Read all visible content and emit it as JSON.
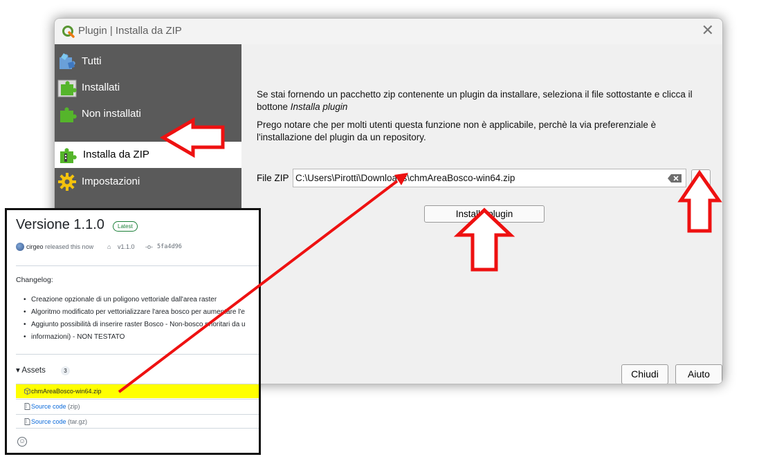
{
  "dialog": {
    "title": "Plugin | Installa da ZIP",
    "close_glyph": "✕"
  },
  "sidebar": {
    "items": [
      {
        "label": "Tutti",
        "icon": "puzzle-multi-icon"
      },
      {
        "label": "Installati",
        "icon": "puzzle-installed-icon"
      },
      {
        "label": "Non installati",
        "icon": "puzzle-icon"
      },
      {
        "label": "Installa da ZIP",
        "icon": "puzzle-zip-icon",
        "active": true
      },
      {
        "label": "Impostazioni",
        "icon": "gear-icon"
      }
    ]
  },
  "content": {
    "intro_text": "Se stai fornendo un pacchetto zip contenente un plugin da installare, seleziona il file sottostante e clicca il bottone ",
    "intro_emphasis": "Installa plugin",
    "note_text": "Prego notare che per molti utenti questa funzione non è applicabile, perchè la via preferenziale è l'installazione del plugin da un repository.",
    "file_label": "File ZIP",
    "file_value": "C:\\Users\\Pirotti\\Downloads\\chmAreaBosco-win64.zip",
    "browse_label": "...",
    "install_button": "Installa plugin"
  },
  "footer": {
    "close_button": "Chiudi",
    "help_button": "Aiuto"
  },
  "release": {
    "version": "Versione 1.1.0",
    "badge": "Latest",
    "author": "cirgeo",
    "released_text": "released this now",
    "tag": "v1.1.0",
    "commit": "5fa4d96",
    "changelog_label": "Changelog:",
    "changelog": [
      "Creazione opzionale di un poligono vettoriale dall'area raster",
      "Algoritmo modificato per vettorializzare l'area bosco per aumentare l'e",
      "Aggiunto possibilità di inserire raster Bosco - Non-bosco prioritari da u",
      "informazioni) - NON TESTATO"
    ],
    "assets_label": "▾ Assets",
    "assets_count": "3",
    "assets": [
      {
        "name": "chmAreaBosco-win64.zip",
        "suffix": "",
        "highlighted": true
      },
      {
        "name": "Source code",
        "suffix": " (zip)"
      },
      {
        "name": "Source code",
        "suffix": " (tar.gz)"
      }
    ]
  },
  "colors": {
    "sidebar_bg": "#5a5a5a",
    "arrow_red": "#ee1111",
    "highlight_yellow": "#ffff00",
    "github_link": "#0969da",
    "latest_green": "#1a7f37"
  }
}
